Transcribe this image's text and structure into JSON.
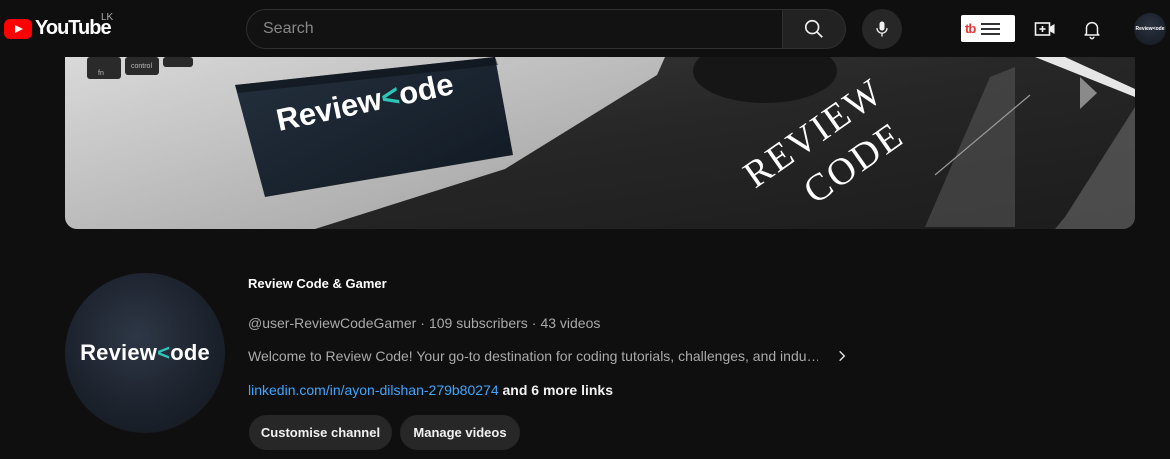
{
  "masthead": {
    "logo_text": "YouTube",
    "country_code": "LK",
    "search_placeholder": "Search",
    "extension_label": "tb",
    "avatar_label": "Review<ode"
  },
  "banner": {
    "laptop_text_a": "Review",
    "laptop_text_b": "<",
    "laptop_text_c": "ode",
    "key_fn": "fn",
    "key_ctrl": "control",
    "line1": "REVIEW",
    "line2": "CODE"
  },
  "channel": {
    "name": "Review Code & Gamer",
    "handle": "@user-ReviewCodeGamer",
    "separator": "·",
    "subscribers": "109 subscribers",
    "videos": "43 videos",
    "description": "Welcome to Review Code! Your go-to destination for coding tutorials, challenges, and indu…",
    "link": "linkedin.com/in/ayon-dilshan-279b80274",
    "more_links": "and 6 more links",
    "avatar_text_a": "Review",
    "avatar_text_b": "<",
    "avatar_text_c": "ode"
  },
  "actions": {
    "customise": "Customise channel",
    "manage": "Manage videos"
  },
  "colors": {
    "background": "#0f0f0f",
    "brand_red": "#ff0000",
    "link_blue": "#3ea6ff",
    "accent_teal": "#2ec4b6"
  },
  "icons": [
    "youtube-logo-icon",
    "search-icon",
    "mic-icon",
    "create-video-icon",
    "bell-icon",
    "chevron-right-icon"
  ]
}
